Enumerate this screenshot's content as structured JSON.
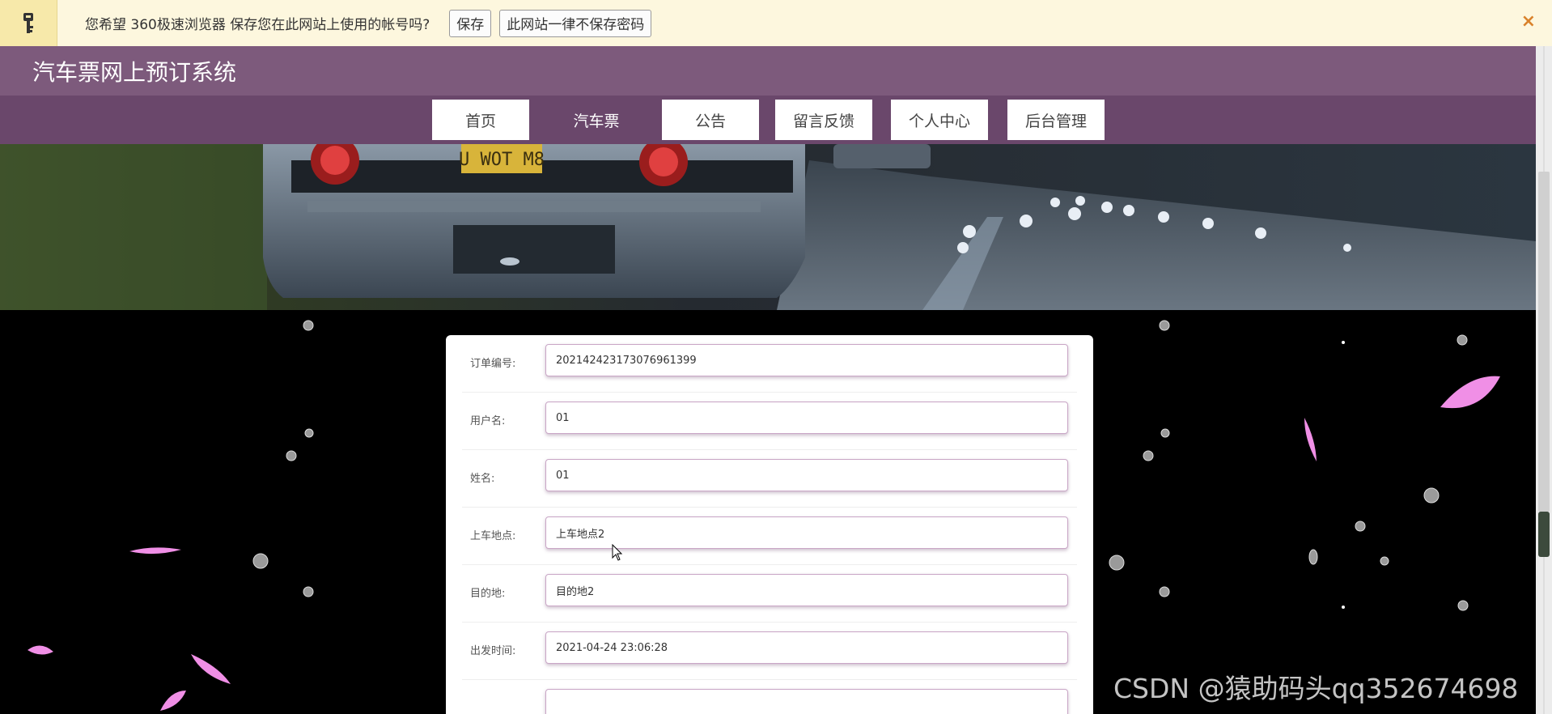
{
  "password_bar": {
    "message": "您希望 360极速浏览器 保存您在此网站上使用的帐号吗?",
    "save_label": "保存",
    "never_label": "此网站一律不保存密码",
    "close_icon": "×"
  },
  "header": {
    "site_title": "汽车票网上预订系统"
  },
  "nav": {
    "items": [
      {
        "label": "首页"
      },
      {
        "label": "汽车票"
      },
      {
        "label": "公告"
      },
      {
        "label": "留言反馈"
      },
      {
        "label": "个人中心"
      },
      {
        "label": "后台管理"
      }
    ],
    "active_index": 1
  },
  "banner": {
    "plate": "U WOT M8"
  },
  "form": {
    "fields": [
      {
        "label": "订单编号:",
        "value": "202142423173076961399"
      },
      {
        "label": "用户名:",
        "value": "01"
      },
      {
        "label": "姓名:",
        "value": "01"
      },
      {
        "label": "上车地点:",
        "value": "上车地点2"
      },
      {
        "label": "目的地:",
        "value": "目的地2"
      },
      {
        "label": "出发时间:",
        "value": "2021-04-24 23:06:28"
      },
      {
        "label": "",
        "value": ""
      }
    ]
  },
  "watermark": "CSDN @猿助码头qq352674698",
  "colors": {
    "title_bar": "#7d5a7c",
    "nav_bar": "#6a476b",
    "password_bar_bg": "#fdf7de",
    "close_icon": "#d9822b",
    "petal": "#f08fe6"
  }
}
